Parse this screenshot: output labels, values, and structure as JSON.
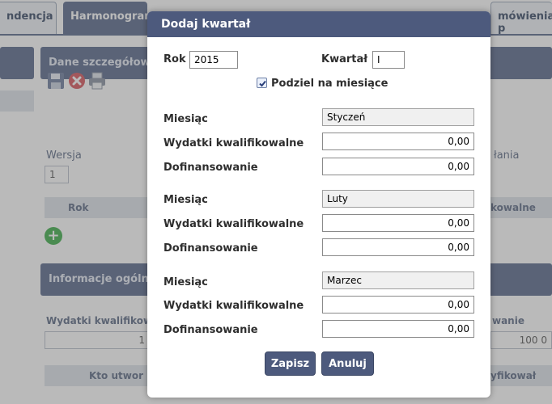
{
  "background": {
    "tabs": [
      "ndencja",
      "Harmonogram",
      "mówienia p"
    ],
    "sections": [
      "Dane szczegółow",
      "Informacje ogólne"
    ],
    "labels": {
      "wersja": "Wersja",
      "wersja_value": "1",
      "rok": "Rok",
      "dzialania": "łania",
      "kwalifikowalne": "kowalne",
      "wydatki_kwal": "Wydatki kwalifikow",
      "wydatki_value": "1",
      "wanie": "wanie",
      "wanie_value": "100 0",
      "kto_utworzyl": "Kto utwor",
      "zweryfikowal": "yfikował"
    }
  },
  "modal": {
    "title": "Dodaj kwartał",
    "rok_label": "Rok",
    "rok_value": "2015",
    "kwartal_label": "Kwartał",
    "kwartal_value": "I",
    "podziel_label": "Podziel na miesiące",
    "podziel_checked": true,
    "months": [
      {
        "miesiac_label": "Miesiąc",
        "miesiac_value": "Styczeń",
        "wydatki_label": "Wydatki kwalifikowalne",
        "wydatki_value": "0,00",
        "dofin_label": "Dofinansowanie",
        "dofin_value": "0,00"
      },
      {
        "miesiac_label": "Miesiąc",
        "miesiac_value": "Luty",
        "wydatki_label": "Wydatki kwalifikowalne",
        "wydatki_value": "0,00",
        "dofin_label": "Dofinansowanie",
        "dofin_value": "0,00"
      },
      {
        "miesiac_label": "Miesiąc",
        "miesiac_value": "Marzec",
        "wydatki_label": "Wydatki kwalifikowalne",
        "wydatki_value": "0,00",
        "dofin_label": "Dofinansowanie",
        "dofin_value": "0,00"
      }
    ],
    "save_label": "Zapisz",
    "cancel_label": "Anuluj"
  },
  "colors": {
    "header": "#4d5a7d",
    "section": "#5b6a8c",
    "add_icon": "#3fae4a"
  },
  "icons": [
    "save-icon",
    "delete-icon",
    "print-icon",
    "add-icon"
  ]
}
